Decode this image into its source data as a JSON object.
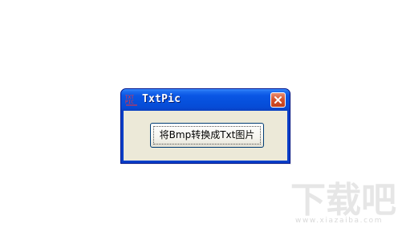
{
  "window": {
    "title": "TxtPic",
    "app_icon": "txtpic-app-icon",
    "close_icon": "close-icon"
  },
  "main": {
    "convert_button_label": "将Bmp转换成Txt图片"
  },
  "watermark": {
    "logo_text": "下载吧",
    "url": "www.xiazaiba.com"
  },
  "colors": {
    "titlebar": "#0650dc",
    "client_background": "#ece9d8",
    "close_button": "#d5542f",
    "button_border": "#003c74"
  }
}
